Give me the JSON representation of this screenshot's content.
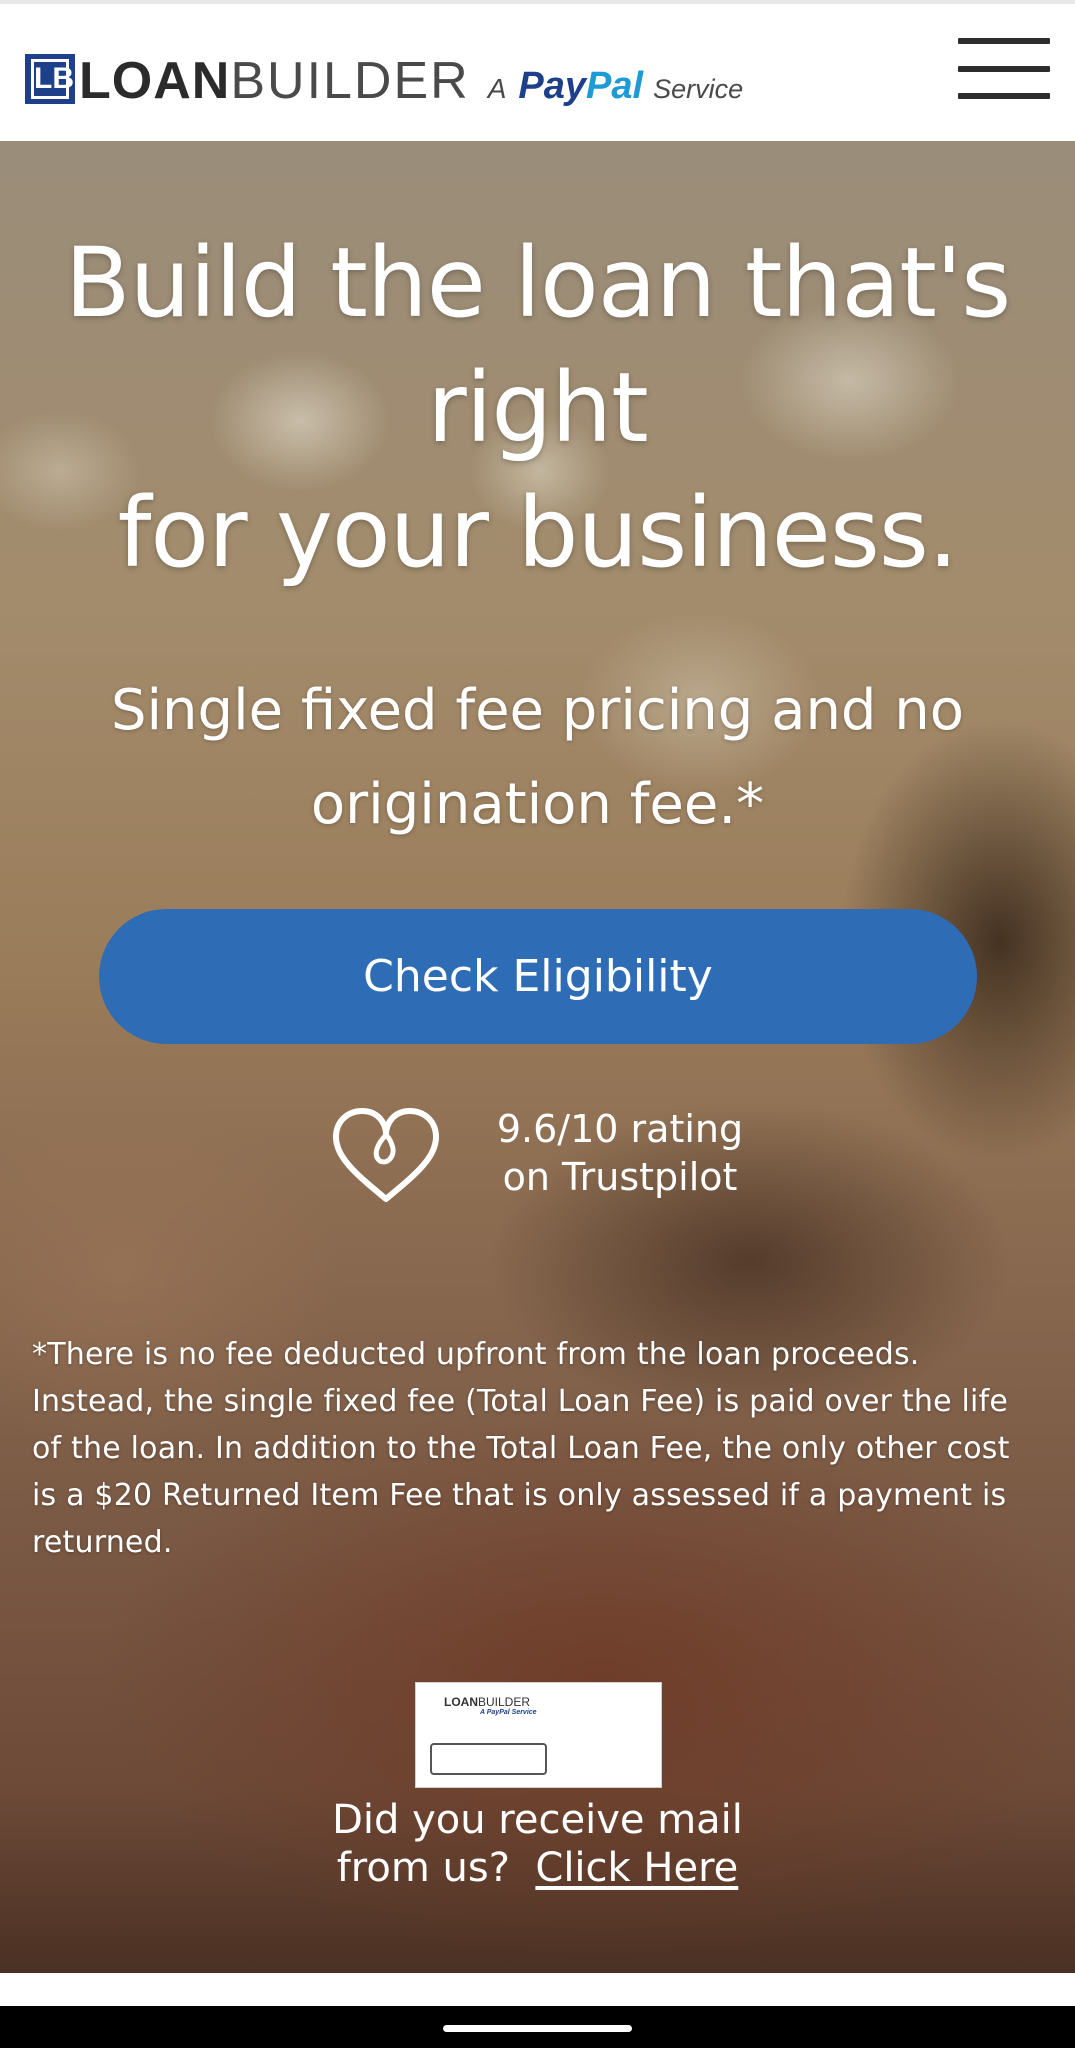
{
  "header": {
    "logo_mark": "LB",
    "logo_loan": "LOAN",
    "logo_builder": "BUILDER",
    "logo_a": "A",
    "logo_pay": "Pay",
    "logo_pal": "Pal",
    "logo_service": "Service",
    "menu_icon": "hamburger-menu-icon"
  },
  "hero": {
    "title_line1": "Build the loan that's",
    "title_line2": "right",
    "title_line3": "for your business.",
    "subtitle": "Single fixed fee pricing and no origination fee.*",
    "cta_label": "Check Eligibility",
    "rating_line1": "9.6/10 rating",
    "rating_line2": "on Trustpilot",
    "rating_icon": "heart-icon",
    "disclaimer": "*There is no fee deducted upfront from the loan proceeds. Instead, the single fixed fee (Total Loan Fee) is paid over the life of the loan. In addition to the Total Loan Fee, the only other cost is a $20 Returned Item Fee that is only assessed if a payment is returned.",
    "mail_line1": "Did you receive mail",
    "mail_line2": "from us?",
    "mail_link": "Click Here"
  },
  "mail_thumbnail": {
    "brand_loan": "LOAN",
    "brand_builder": "BUILDER",
    "brand_sub": "A PayPal Service"
  },
  "colors": {
    "primary_button": "#2e6db5",
    "logo_navy": "#1e3f8a",
    "logo_light_blue": "#1d9bd6",
    "header_bg": "#ffffff",
    "hero_text": "#ffffff"
  }
}
